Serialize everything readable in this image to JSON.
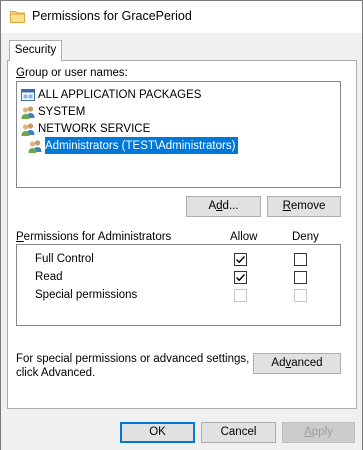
{
  "window": {
    "title": "Permissions for GracePeriod"
  },
  "tabs": [
    {
      "label": "Security"
    }
  ],
  "group_section": {
    "label_prefix": "",
    "label_accel": "G",
    "label_rest": "roup or user names:",
    "items": [
      {
        "label": "ALL APPLICATION PACKAGES",
        "icon": "app-packages-icon",
        "selected": false
      },
      {
        "label": "SYSTEM",
        "icon": "users-icon",
        "selected": false
      },
      {
        "label": "NETWORK SERVICE",
        "icon": "users-icon",
        "selected": false
      },
      {
        "label": "Administrators (TEST\\Administrators)",
        "icon": "users-icon",
        "selected": true
      }
    ]
  },
  "buttons": {
    "add_pre": "A",
    "add_accel": "d",
    "add_post": "d...",
    "remove_accel": "R",
    "remove_post": "emove",
    "advanced_pre": "Ad",
    "advanced_accel": "v",
    "advanced_post": "anced",
    "ok": "OK",
    "cancel": "Cancel",
    "apply_accel": "A",
    "apply_post": "pply"
  },
  "permissions": {
    "label_accel": "P",
    "label_rest": "ermissions for Administrators",
    "col_allow": "Allow",
    "col_deny": "Deny",
    "rows": [
      {
        "name": "Full Control",
        "allow": true,
        "deny": false,
        "enabled": true
      },
      {
        "name": "Read",
        "allow": true,
        "deny": false,
        "enabled": true
      },
      {
        "name": "Special permissions",
        "allow": false,
        "deny": false,
        "enabled": false
      }
    ]
  },
  "advanced_note": {
    "line1": "For special permissions or advanced settings,",
    "line2": "click Advanced."
  },
  "colors": {
    "selection": "#0078d7",
    "accent_border": "#0078d7"
  }
}
